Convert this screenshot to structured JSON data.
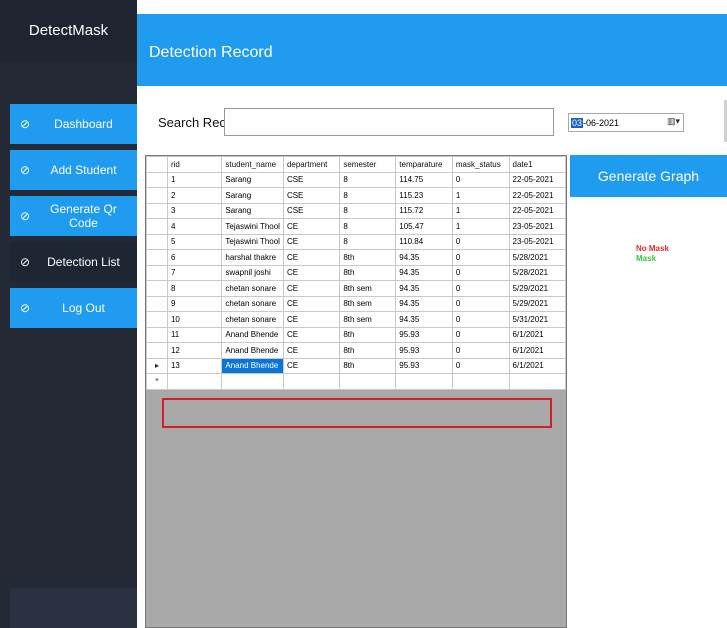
{
  "app": {
    "brand": "DetectMask"
  },
  "sidebar": {
    "items": [
      {
        "label": "Dashboard",
        "icon": "check-circle-icon",
        "active": true
      },
      {
        "label": "Add Student",
        "icon": "check-circle-icon",
        "active": true
      },
      {
        "label": "Generate Qr Code",
        "icon": "check-circle-icon",
        "active": true
      },
      {
        "label": "Detection List",
        "icon": "check-circle-icon",
        "active": false
      },
      {
        "label": "Log Out",
        "icon": "check-circle-icon",
        "active": true
      }
    ],
    "icon_glyph": "⊘"
  },
  "header": {
    "title": "Detection Record"
  },
  "search": {
    "label": "Search Record",
    "value": ""
  },
  "date": {
    "selected_part": "03",
    "rest": "-06-2021",
    "dropdown_glyph": "▥▾"
  },
  "grid": {
    "columns": [
      "rid",
      "student_name",
      "department",
      "semester",
      "temparature",
      "mask_status",
      "date1"
    ],
    "rows": [
      [
        "1",
        "Sarang",
        "CSE",
        "8",
        "114.75",
        "0",
        "22-05-2021"
      ],
      [
        "2",
        "Sarang",
        "CSE",
        "8",
        "115.23",
        "1",
        "22-05-2021"
      ],
      [
        "3",
        "Sarang",
        "CSE",
        "8",
        "115.72",
        "1",
        "22-05-2021"
      ],
      [
        "4",
        "Tejaswini Thool",
        "CE",
        "8",
        "105.47",
        "1",
        "23-05-2021"
      ],
      [
        "5",
        "Tejaswini Thool",
        "CE",
        "8",
        "110.84",
        "0",
        "23-05-2021"
      ],
      [
        "6",
        "harshal thakre",
        "CE",
        "8th",
        "94.35",
        "0",
        "5/28/2021"
      ],
      [
        "7",
        "swapnil joshi",
        "CE",
        "8th",
        "94.35",
        "0",
        "5/28/2021"
      ],
      [
        "8",
        "chetan sonare",
        "CE",
        "8th sem",
        "94.35",
        "0",
        "5/29/2021"
      ],
      [
        "9",
        "chetan sonare",
        "CE",
        "8th sem",
        "94.35",
        "0",
        "5/29/2021"
      ],
      [
        "10",
        "chetan sonare",
        "CE",
        "8th sem",
        "94.35",
        "0",
        "5/31/2021"
      ],
      [
        "11",
        "Anand Bhende",
        "CE",
        "8th",
        "95.93",
        "0",
        "6/1/2021"
      ],
      [
        "12",
        "Anand Bhende",
        "CE",
        "8th",
        "95.93",
        "0",
        "6/1/2021"
      ],
      [
        "13",
        "Anand Bhende",
        "CE",
        "8th",
        "95.93",
        "0",
        "6/1/2021"
      ]
    ],
    "current_row_marker": "▸",
    "new_row_marker": "*"
  },
  "graph": {
    "button_label": "Generate Graph",
    "legend": [
      {
        "label": "No Mask",
        "color": "#e52b2b"
      },
      {
        "label": "Mask",
        "color": "#39c63c"
      }
    ]
  },
  "colors": {
    "accent": "#1f9bf0",
    "sidebar": "#232a35",
    "highlight": "#d21f2a",
    "selection": "#0a75d8"
  }
}
